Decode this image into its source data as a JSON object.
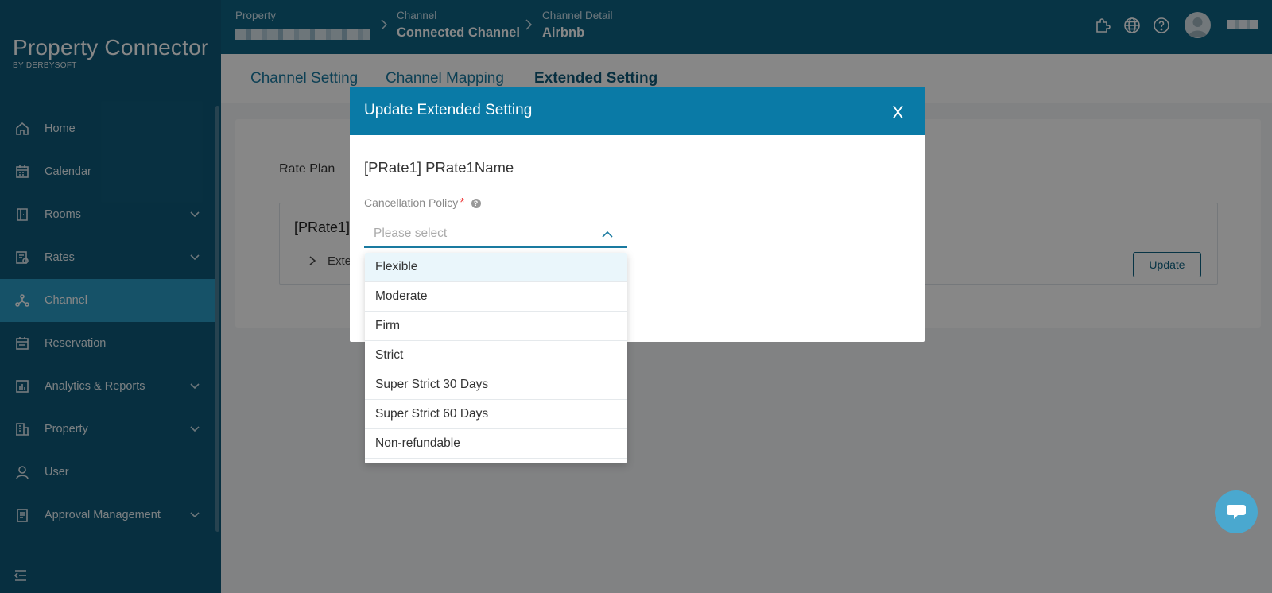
{
  "brand": {
    "name": "Property Connector",
    "sub": "BY DERBYSOFT"
  },
  "sidebar": {
    "items": [
      {
        "label": "Home",
        "icon": "home-icon",
        "has_chevron": false,
        "active": false
      },
      {
        "label": "Calendar",
        "icon": "calendar-icon",
        "has_chevron": false,
        "active": false
      },
      {
        "label": "Rooms",
        "icon": "door-icon",
        "has_chevron": true,
        "active": false
      },
      {
        "label": "Rates",
        "icon": "rates-icon",
        "has_chevron": true,
        "active": false
      },
      {
        "label": "Channel",
        "icon": "channel-icon",
        "has_chevron": false,
        "active": true
      },
      {
        "label": "Reservation",
        "icon": "reservation-icon",
        "has_chevron": false,
        "active": false
      },
      {
        "label": "Analytics & Reports",
        "icon": "analytics-icon",
        "has_chevron": true,
        "active": false
      },
      {
        "label": "Property",
        "icon": "building-icon",
        "has_chevron": true,
        "active": false
      },
      {
        "label": "User",
        "icon": "user-icon",
        "has_chevron": false,
        "active": false
      },
      {
        "label": "Approval Management",
        "icon": "clipboard-icon",
        "has_chevron": true,
        "active": false
      }
    ]
  },
  "breadcrumb": {
    "property_label": "Property",
    "channel_label": "Channel",
    "channel_value": "Connected Channel",
    "detail_label": "Channel Detail",
    "detail_value": "Airbnb"
  },
  "tabs": [
    "Channel Setting",
    "Channel Mapping",
    "Extended Setting"
  ],
  "active_tab": "Extended Setting",
  "content": {
    "rate_plan_label": "Rate Plan",
    "rate_title": "[PRate1]",
    "expand_label": "Exte",
    "update_button": "Update"
  },
  "modal": {
    "title": "Update Extended Setting",
    "close_label": "X",
    "rate_name": "[PRate1] PRate1Name",
    "field_label": "Cancellation Policy",
    "required_mark": "*",
    "help_mark": "?",
    "placeholder": "Please select"
  },
  "dropdown": {
    "options": [
      "Flexible",
      "Moderate",
      "Firm",
      "Strict",
      "Super Strict 30 Days",
      "Super Strict 60 Days",
      "Non-refundable"
    ],
    "hovered": "Flexible"
  },
  "colors": {
    "sidebar_bg": "#0f5a7a",
    "topbar_bg": "#0f6283",
    "active_nav": "#2b9bc4",
    "modal_header": "#0a7aa6",
    "chat_bubble": "#4aa8cf"
  }
}
